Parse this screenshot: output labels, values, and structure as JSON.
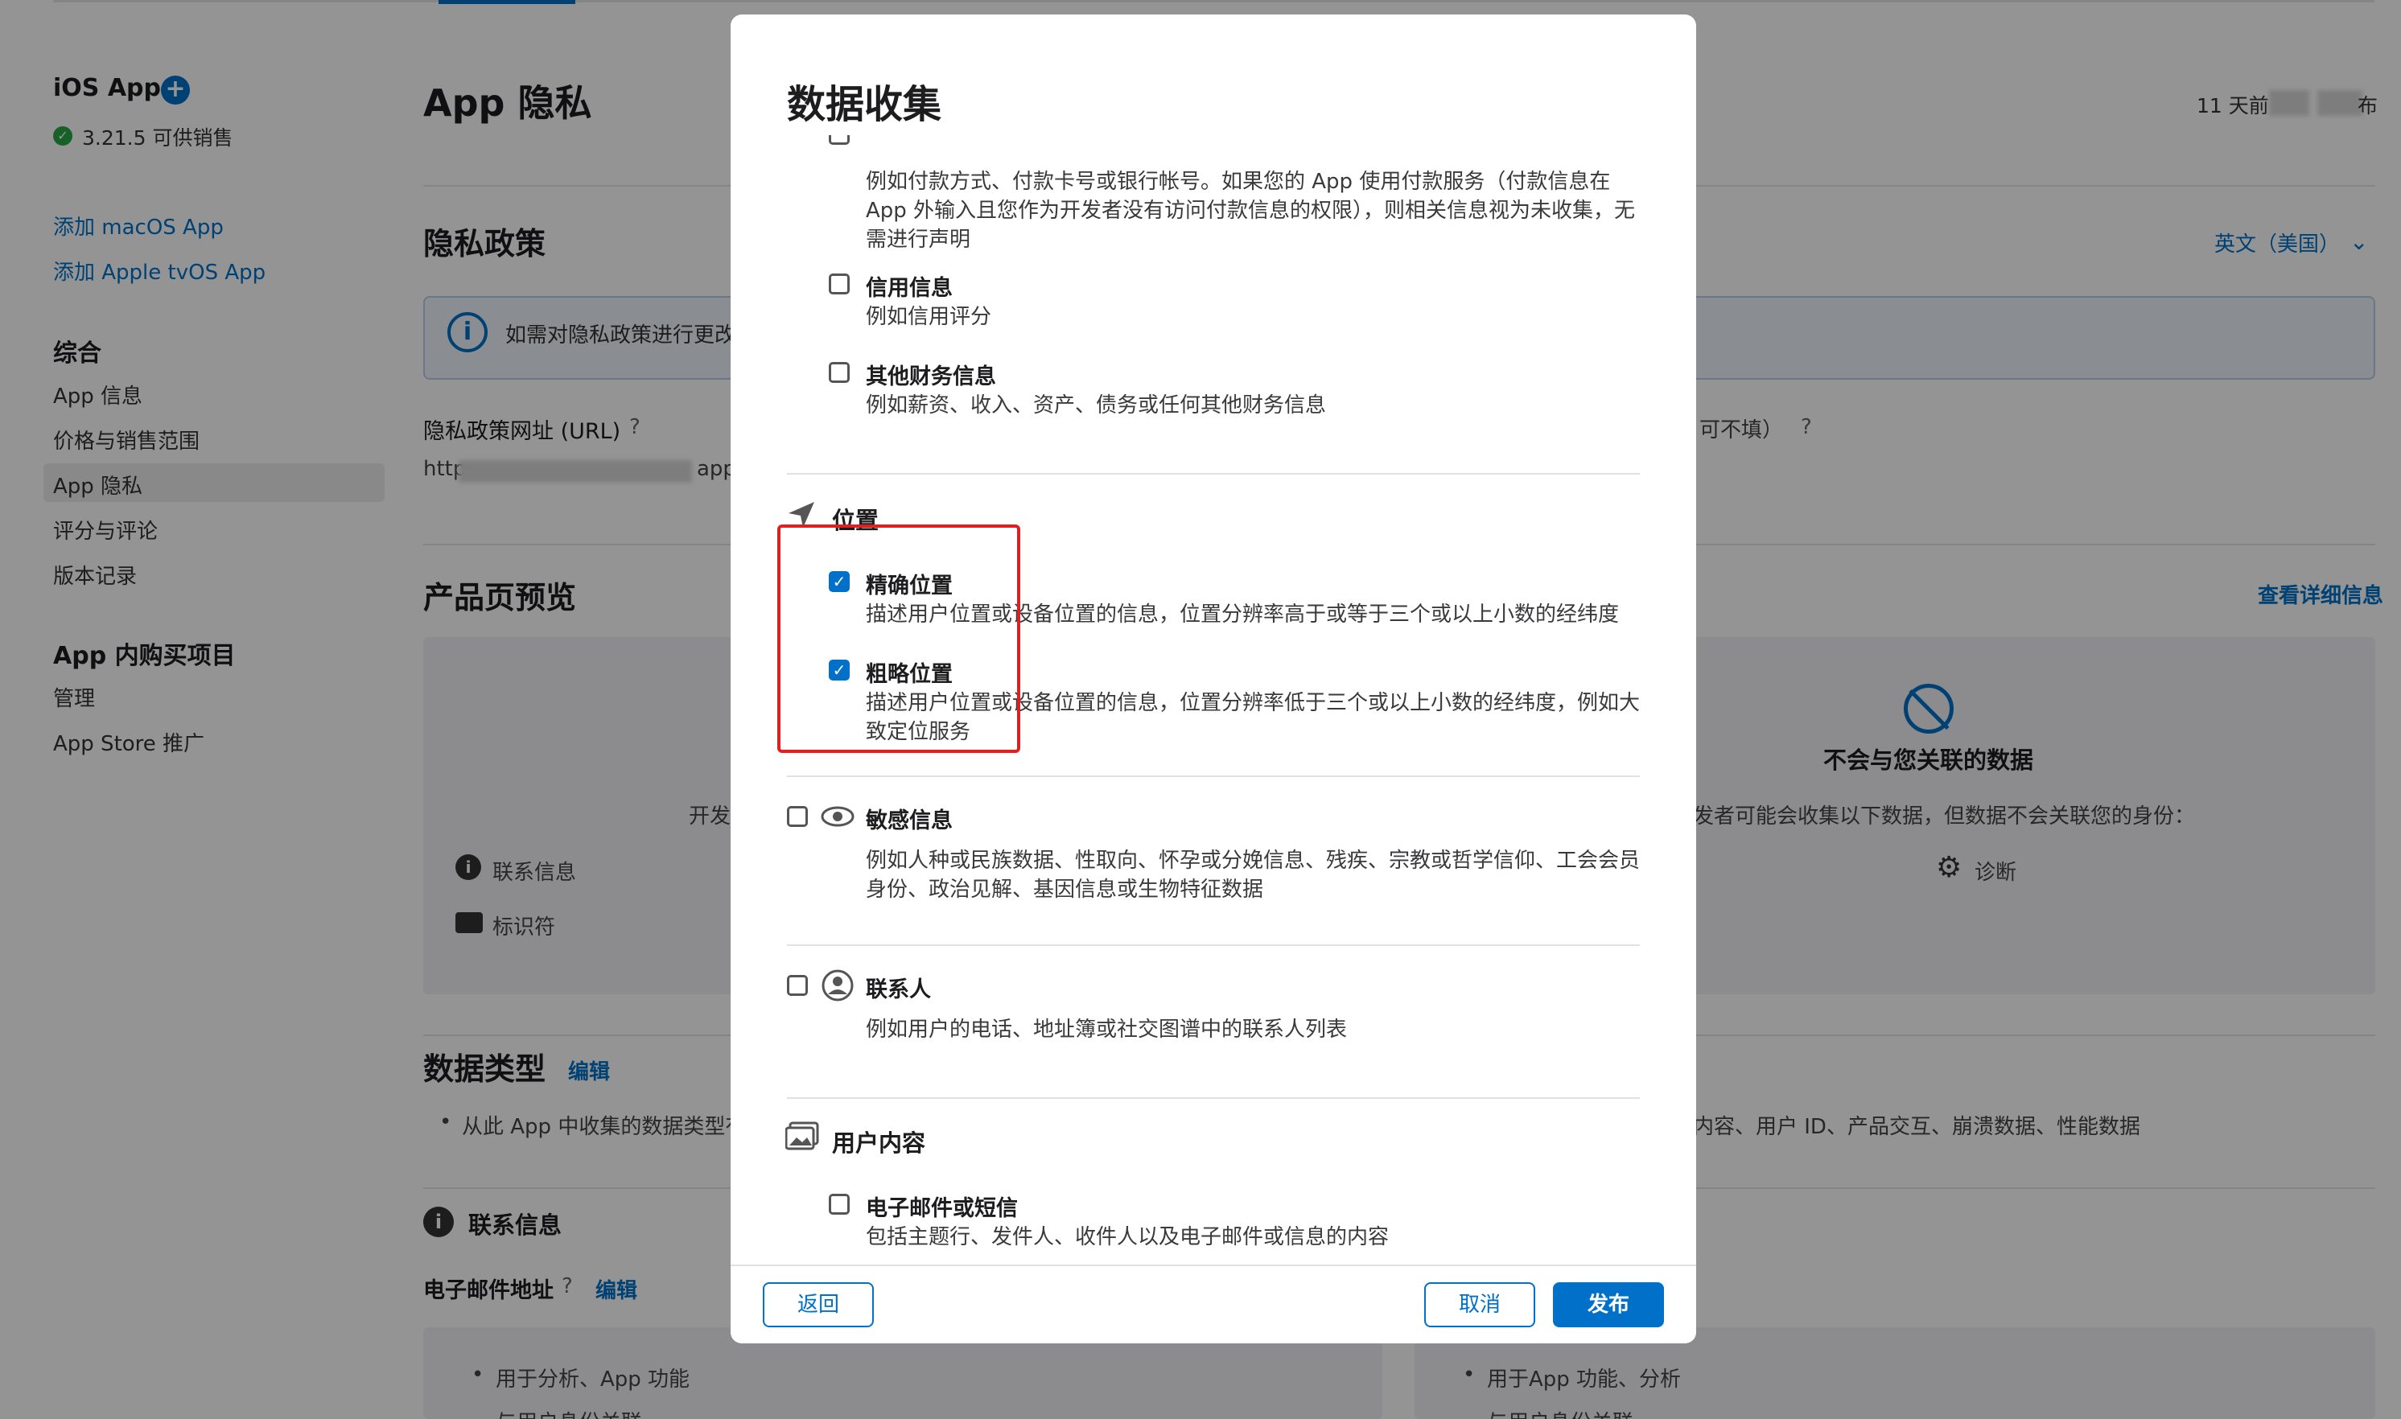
{
  "sidebar": {
    "app_title": "iOS App",
    "status": "3.21.5 可供销售",
    "add_macos": "添加 macOS App",
    "add_tvos": "添加 Apple tvOS App",
    "general_head": "综合",
    "items": [
      "App 信息",
      "价格与销售范围",
      "App 隐私",
      "评分与评论",
      "版本记录"
    ],
    "iap_head": "App 内购买项目",
    "iap_items": [
      "管理",
      "App Store 推广"
    ]
  },
  "main": {
    "page_title": "App 隐私",
    "time_text": "11 天前",
    "time_suffix": "布",
    "privacy_policy_title": "隐私政策",
    "lang_select": "英文（美国）",
    "banner_text": "如需对隐私政策进行更改",
    "url_label": "隐私政策网址 (URL)",
    "url_prefix": "http",
    "url_suffix": "app/",
    "optional_suffix": "可不填）",
    "preview_title": "产品页预览",
    "view_details": "查看详细信息",
    "dev_text": "开发",
    "contact_info": "联系信息",
    "identifiers": "标识符",
    "not_linked_title": "不会与您关联的数据",
    "not_linked_desc": "发者可能会收集以下数据，但数据不会关联您的身份：",
    "diagnostics": "诊断",
    "data_types_title": "数据类型",
    "edit": "编辑",
    "data_types_bullet": "从此 App 中收集的数据类型有",
    "data_types_right": "内容、用户 ID、产品交互、崩溃数据、性能数据",
    "contact_section": "联系信息",
    "email_label": "电子邮件地址",
    "email_edit": "编辑",
    "bottom_left_bullet": "用于分析、App 功能",
    "bottom_left_bullet2": "与用户身份关联",
    "bottom_right_bullet": "用于App 功能、分析",
    "bottom_right_bullet2": "与用户身份关联"
  },
  "modal": {
    "title": "数据收集",
    "payment_desc": "例如付款方式、付款卡号或银行帐号。如果您的 App 使用付款服务（付款信息在 App 外输入且您作为开发者没有访问付款信息的权限），则相关信息视为未收集，无需进行声明",
    "credit_title": "信用信息",
    "credit_desc": "例如信用评分",
    "other_fin_title": "其他财务信息",
    "other_fin_desc": "例如薪资、收入、资产、债务或任何其他财务信息",
    "location_title": "位置",
    "precise_title": "精确位置",
    "precise_desc": "描述用户位置或设备位置的信息，位置分辨率高于或等于三个或以上小数的经纬度",
    "coarse_title": "粗略位置",
    "coarse_desc": "描述用户位置或设备位置的信息，位置分辨率低于三个或以上小数的经纬度，例如大致定位服务",
    "sensitive_title": "敏感信息",
    "sensitive_desc": "例如人种或民族数据、性取向、怀孕或分娩信息、残疾、宗教或哲学信仰、工会会员身份、政治见解、基因信息或生物特征数据",
    "contacts_title": "联系人",
    "contacts_desc": "例如用户的电话、地址簿或社交图谱中的联系人列表",
    "user_content_title": "用户内容",
    "email_sms_title": "电子邮件或短信",
    "email_sms_desc": "包括主题行、发件人、收件人以及电子邮件或信息的内容",
    "precise_checked": true,
    "coarse_checked": true,
    "back_button": "返回",
    "cancel_button": "取消",
    "publish_button": "发布",
    "check_glyph": "✓"
  },
  "colors": {
    "accent": "#0070c9",
    "highlight": "#e02020"
  }
}
